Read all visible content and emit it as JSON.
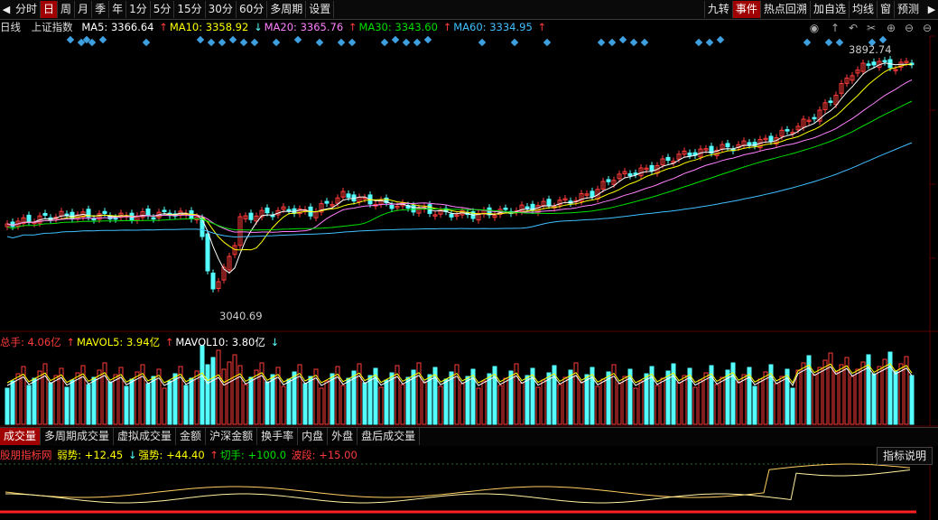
{
  "toolbar": {
    "periods": [
      "分时",
      "日",
      "周",
      "月",
      "季",
      "年",
      "1分",
      "5分",
      "15分",
      "30分",
      "60分",
      "多周期",
      "设置"
    ],
    "active_period": "日",
    "right_buttons": [
      "九转",
      "事件",
      "热点回溯",
      "加自选",
      "均线",
      "窗",
      "预测"
    ],
    "active_right": "事件"
  },
  "main_legend": {
    "period": "日线",
    "name": "上证指数",
    "ma5": "MA5: 3366.64",
    "ma10": "MA10: 3358.92",
    "ma20": "MA20: 3365.76",
    "ma30": "MA30: 3343.60",
    "ma60": "MA60: 3334.95"
  },
  "annotations": {
    "high": "3892.74",
    "low": "3040.69"
  },
  "volume_legend": {
    "total": "总手: 4.06亿",
    "mavol5": "MAVOL5: 3.94亿",
    "mavol10": "MAVOL10: 3.80亿"
  },
  "sub_tabs": [
    "成交量",
    "多周期成交量",
    "虚拟成交量",
    "金额",
    "沪深金额",
    "换手率",
    "内盘",
    "外盘",
    "盘后成交量"
  ],
  "active_sub_tab": "成交量",
  "indicator_legend": {
    "name": "股朋指标网",
    "weak": "弱势: +12.45",
    "strong": "强势: +44.40",
    "cut": "切手: +100.0",
    "band": "波段: +15.00"
  },
  "indicator_explain": "指标说明",
  "colors": {
    "up": "#ff3b3b",
    "down": "#54ffff",
    "ma5": "#ffffff",
    "ma10": "#ffff00",
    "ma20": "#ff80ff",
    "ma30": "#00e000",
    "ma60": "#40c0ff",
    "grid": "#5a0000",
    "active": "#a00000"
  },
  "icons": [
    "eye-icon",
    "up-arrow-icon",
    "undo-icon",
    "scissors-icon",
    "plus-circle-icon",
    "minus-circle-icon"
  ]
}
